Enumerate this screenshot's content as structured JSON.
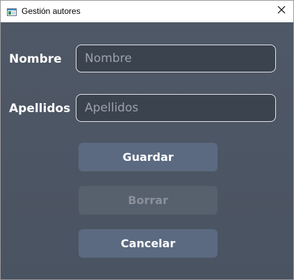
{
  "window": {
    "title": "Gestión autores",
    "icon": "window-app-icon",
    "close_icon": "close-icon"
  },
  "form": {
    "nombre": {
      "label": "Nombre",
      "value": "",
      "placeholder": "Nombre"
    },
    "apellidos": {
      "label": "Apellidos",
      "value": "",
      "placeholder": "Apellidos"
    }
  },
  "buttons": {
    "guardar": {
      "label": "Guardar",
      "enabled": true
    },
    "borrar": {
      "label": "Borrar",
      "enabled": false
    },
    "cancelar": {
      "label": "Cancelar",
      "enabled": true
    }
  },
  "colors": {
    "background": "#4f5866",
    "input_background": "#3b434e",
    "button_background": "#5b6a80",
    "button_disabled_background": "#57606d",
    "button_disabled_text": "#8a919b",
    "text": "#ffffff",
    "placeholder": "#9ba2ad"
  }
}
